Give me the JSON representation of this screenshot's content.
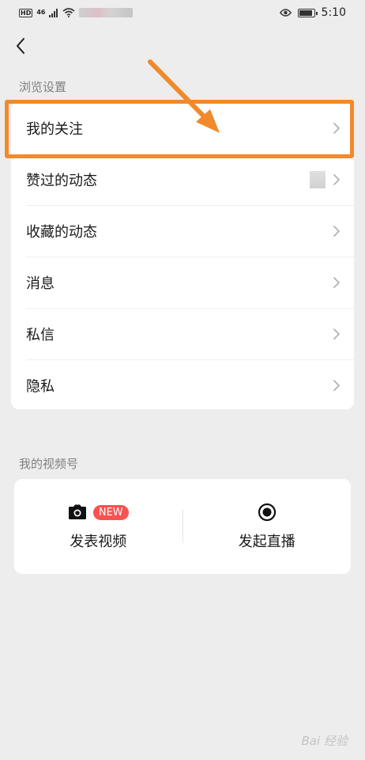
{
  "status_bar": {
    "hd": "HD",
    "signal": "46",
    "time": "5:10"
  },
  "browse_section": {
    "title": "浏览设置",
    "items": [
      {
        "label": "我的关注"
      },
      {
        "label": "赞过的动态"
      },
      {
        "label": "收藏的动态"
      },
      {
        "label": "消息"
      },
      {
        "label": "私信"
      },
      {
        "label": "隐私"
      }
    ]
  },
  "channels_section": {
    "title": "我的视频号",
    "post_video": {
      "label": "发表视频",
      "badge": "NEW",
      "icon": "camera-icon"
    },
    "go_live": {
      "label": "发起直播",
      "icon": "live-record-icon"
    }
  },
  "watermark": "Bai 经验",
  "colors": {
    "highlight": "#f08a2c",
    "badge": "#fa5151",
    "background": "#ededed"
  }
}
